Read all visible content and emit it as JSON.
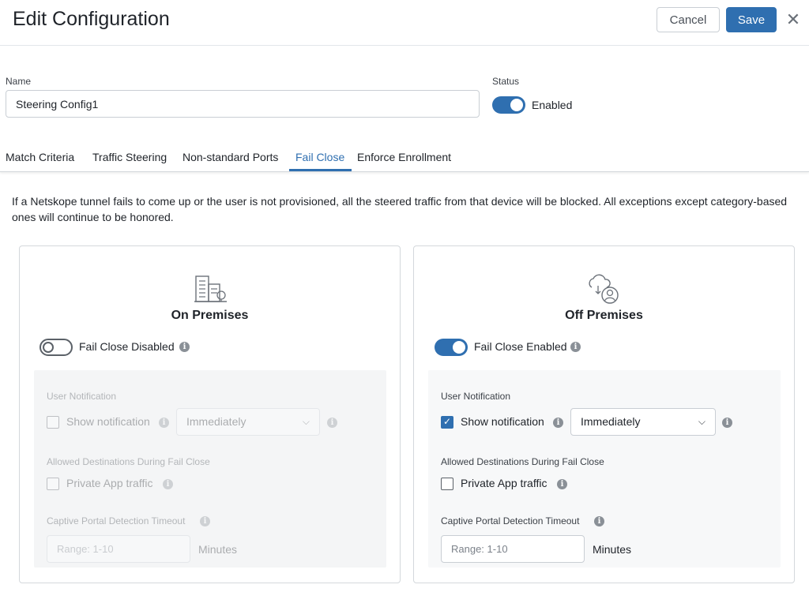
{
  "header": {
    "title": "Edit Configuration",
    "cancel_label": "Cancel",
    "save_label": "Save",
    "close_icon": "close-icon"
  },
  "form": {
    "name_label": "Name",
    "name_value": "Steering Config1",
    "status_label": "Status",
    "status_text": "Enabled",
    "status_enabled": true
  },
  "tabs": [
    {
      "label": "Match Criteria",
      "active": false
    },
    {
      "label": "Traffic Steering",
      "active": false
    },
    {
      "label": "Non-standard Ports",
      "active": false
    },
    {
      "label": "Fail Close",
      "active": true
    },
    {
      "label": "Enforce Enrollment",
      "active": false
    }
  ],
  "description": "If a Netskope tunnel fails to come up or the user is not provisioned, all the steered traffic from that device will be blocked. All exceptions except category-based ones will continue to be honored.",
  "cards": [
    {
      "title": "On Premises",
      "icon": "building-icon",
      "fail_close_label": "Fail Close Disabled",
      "fail_close_enabled": false,
      "user_notification_label": "User Notification",
      "show_notification_label": "Show notification",
      "show_notification_checked": false,
      "timing_value": "Immediately",
      "allowed_destinations_label": "Allowed Destinations During Fail Close",
      "private_app_label": "Private App traffic",
      "private_app_checked": false,
      "timeout_label": "Captive Portal Detection Timeout",
      "timeout_placeholder": "Range: 1-10",
      "minutes_label": "Minutes"
    },
    {
      "title": "Off Premises",
      "icon": "cloud-user-icon",
      "fail_close_label": "Fail Close Enabled",
      "fail_close_enabled": true,
      "user_notification_label": "User Notification",
      "show_notification_label": "Show notification",
      "show_notification_checked": true,
      "timing_value": "Immediately",
      "allowed_destinations_label": "Allowed Destinations During Fail Close",
      "private_app_label": "Private App traffic",
      "private_app_checked": false,
      "timeout_label": "Captive Portal Detection Timeout",
      "timeout_placeholder": "Range: 1-10",
      "minutes_label": "Minutes"
    }
  ],
  "colors": {
    "accent": "#2f6fb0",
    "border": "#c9ced4"
  }
}
